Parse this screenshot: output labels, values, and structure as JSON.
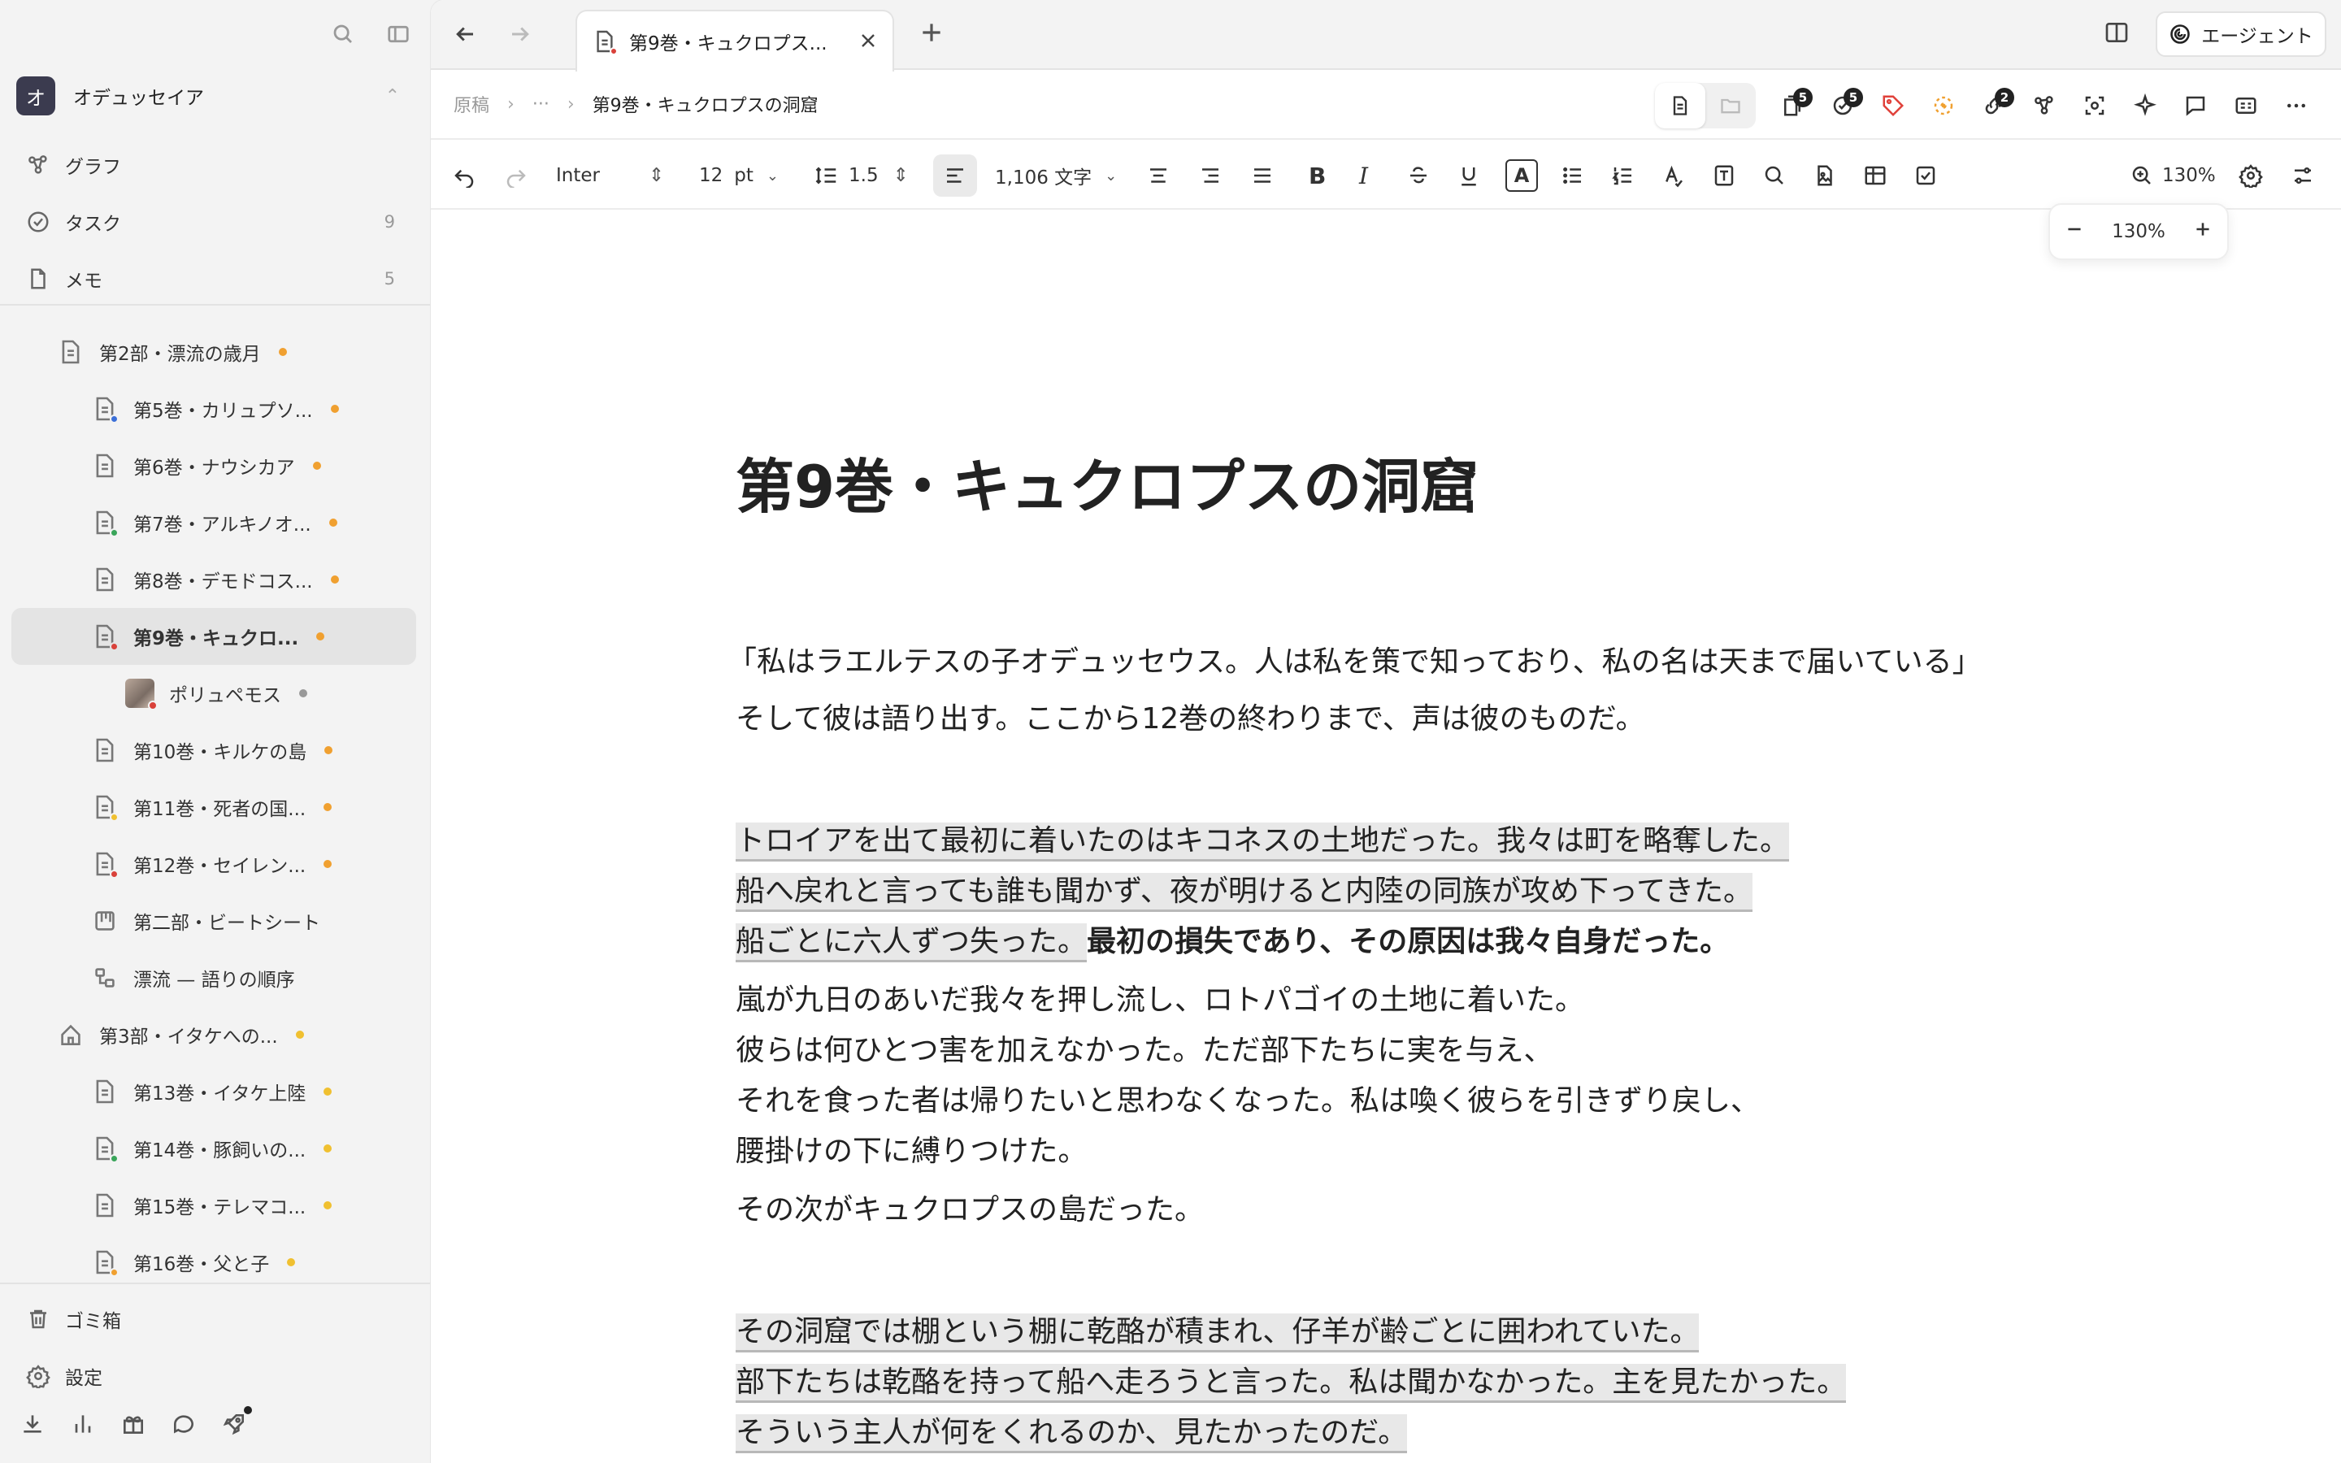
{
  "sidebar": {
    "workspace": {
      "initial": "オ",
      "name": "オデュッセイア"
    },
    "nav": [
      {
        "label": "グラフ",
        "count": ""
      },
      {
        "label": "タスク",
        "count": "9"
      },
      {
        "label": "メモ",
        "count": "5"
      }
    ],
    "tree": [
      {
        "label": "第2部・漂流の歳月",
        "dot": "#f0a030"
      },
      {
        "label": "第5巻・カリュプソ...",
        "dot": "#f0a030",
        "mini": "#3b6fd8"
      },
      {
        "label": "第6巻・ナウシカア",
        "dot": "#f0a030"
      },
      {
        "label": "第7巻・アルキノオ...",
        "dot": "#f0a030",
        "mini": "#3aa55a"
      },
      {
        "label": "第8巻・デモドコス...",
        "dot": "#f0a030"
      },
      {
        "label": "第9巻・キュクロ...",
        "dot": "#f0a030",
        "mini": "#d9413a"
      },
      {
        "label": "ポリュペモス",
        "dot": "#999999",
        "mini": "#d9413a"
      },
      {
        "label": "第10巻・キルケの島",
        "dot": "#f0a030"
      },
      {
        "label": "第11巻・死者の国...",
        "dot": "#f0a030",
        "mini": "#f0c030"
      },
      {
        "label": "第12巻・セイレン...",
        "dot": "#f0a030",
        "mini": "#d9413a"
      },
      {
        "label": "第二部・ビートシート",
        "dot": ""
      },
      {
        "label": "漂流 — 語りの順序",
        "dot": ""
      },
      {
        "label": "第3部・イタケへの...",
        "dot": "#f0c030"
      },
      {
        "label": "第13巻・イタケ上陸",
        "dot": "#f0c030"
      },
      {
        "label": "第14巻・豚飼いの...",
        "dot": "#f0c030",
        "mini": "#3aa55a"
      },
      {
        "label": "第15巻・テレマコ...",
        "dot": "#f0c030"
      },
      {
        "label": "第16巻・父と子",
        "dot": "#f0c030",
        "mini": "#f0a030"
      }
    ],
    "bottom": [
      {
        "label": "ゴミ箱"
      },
      {
        "label": "設定"
      }
    ]
  },
  "tabbar": {
    "tab_title": "第9巻・キュクロプス...",
    "agent_label": "エージェント"
  },
  "breadcrumb": {
    "root": "原稿",
    "ellipsis": "···",
    "current": "第9巻・キュクロプスの洞窟"
  },
  "toolbar_badges": {
    "pages": "5",
    "tasks": "5",
    "links": "2"
  },
  "format": {
    "font": "Inter",
    "size": "12",
    "unit": "pt",
    "line_height": "1.5",
    "word_count": "1,106 文字",
    "bold": "B",
    "italic": "I",
    "text_color": "A",
    "zoom": "130%"
  },
  "zoom_popup": {
    "minus": "−",
    "value": "130%",
    "plus": "+"
  },
  "document": {
    "title": "第9巻・キュクロプスの洞窟",
    "p1": "「私はラエルテスの子オデュッセウス。人は私を策で知っており、私の名は天まで届いている」",
    "p2": "そして彼は語り出す。ここから12巻の終わりまで、声は彼のものだ。",
    "h1_l1": "トロイアを出て最初に着いたのはキコネスの土地だった。我々は町を略奪した。",
    "h1_l2": "船へ戻れと言っても誰も聞かず、夜が明けると内陸の同族が攻め下ってきた。",
    "h1_l3": "船ごとに六人ずつ失った。",
    "h1_bold": "最初の損失であり、その原因は我々自身だった。",
    "p3_l1": "嵐が九日のあいだ我々を押し流し、ロトパゴイの土地に着いた。",
    "p3_l2": "彼らは何ひとつ害を加えなかった。ただ部下たちに実を与え、",
    "p3_l3": "それを食った者は帰りたいと思わなくなった。私は喚く彼らを引きずり戻し、",
    "p3_l4": "腰掛けの下に縛りつけた。",
    "p4": "その次がキュクロプスの島だった。",
    "h2_l1": "その洞窟では棚という棚に乾酪が積まれ、仔羊が齢ごとに囲われていた。",
    "h2_l2": "部下たちは乾酪を持って船へ走ろうと言った。私は聞かなかった。主を見たかった。",
    "h2_l3": "そういう主人が何をくれるのか、見たかったのだ。"
  }
}
